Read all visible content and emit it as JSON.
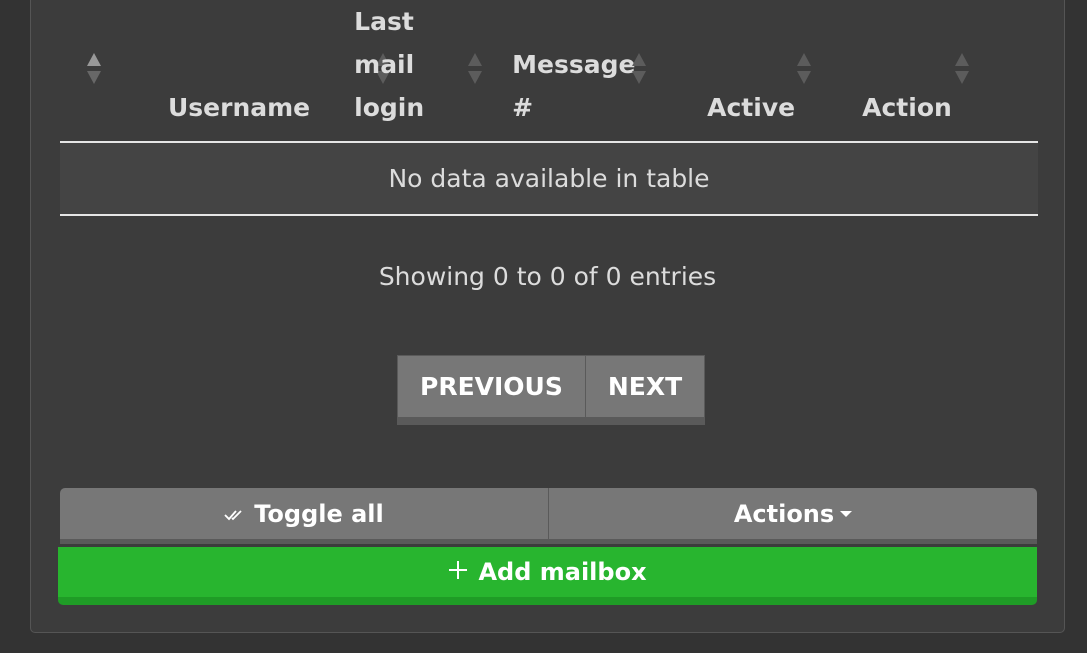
{
  "table": {
    "columns": [
      {
        "label": ""
      },
      {
        "label": "Username"
      },
      {
        "label": "Last mail login"
      },
      {
        "label": "Message #"
      },
      {
        "label": "Active"
      },
      {
        "label": "Action"
      }
    ],
    "empty_message": "No data available in table"
  },
  "info_text": "Showing 0 to 0 of 0 entries",
  "pagination": {
    "previous_label": "PREVIOUS",
    "next_label": "NEXT"
  },
  "toolbar": {
    "toggle_all_label": "Toggle all",
    "actions_label": "Actions"
  },
  "add_mailbox_label": "Add mailbox",
  "colors": {
    "background": "#333333",
    "panel": "#3c3c3c",
    "button_gray": "#777777",
    "button_green": "#28b52f",
    "text": "#dcdcdc"
  },
  "icons": [
    "sort-icon",
    "check-double-icon",
    "caret-down-icon",
    "plus-icon"
  ]
}
